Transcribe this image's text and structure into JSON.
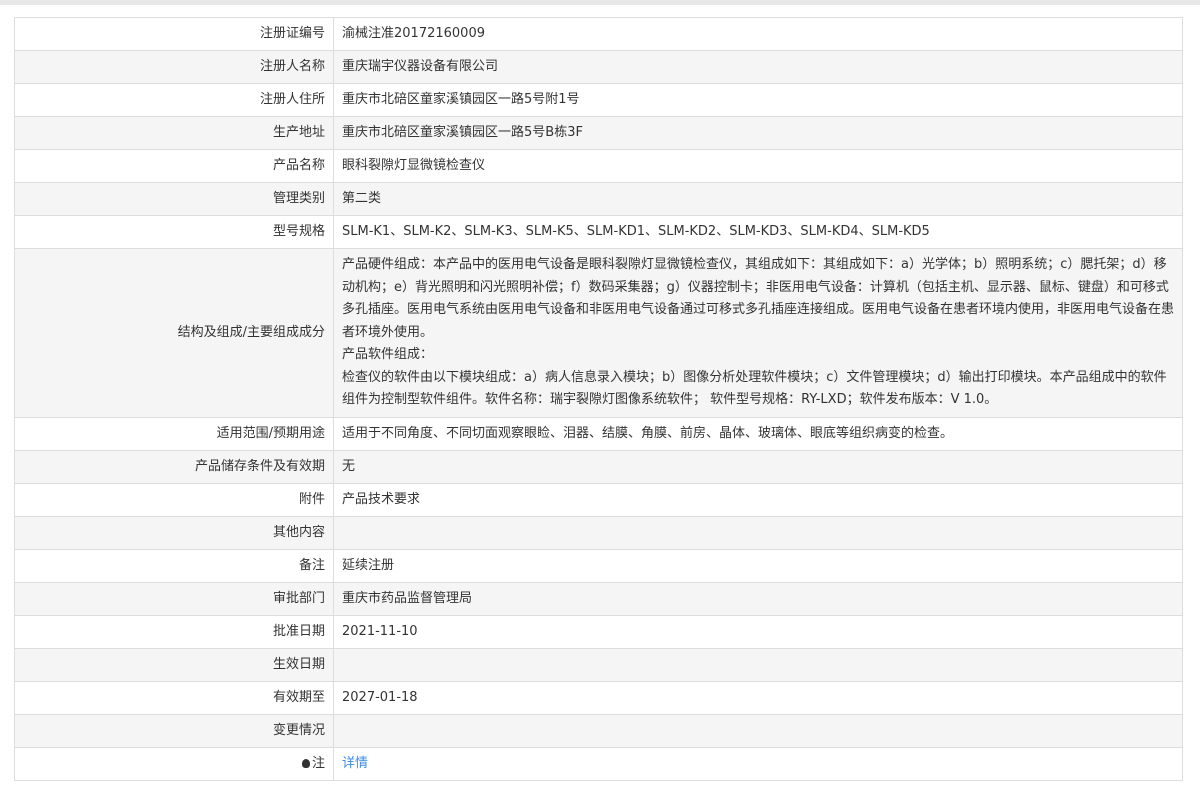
{
  "rows": [
    {
      "label": "注册证编号",
      "value": "渝械注准20172160009"
    },
    {
      "label": "注册人名称",
      "value": "重庆瑞宇仪器设备有限公司"
    },
    {
      "label": "注册人住所",
      "value": "重庆市北碚区童家溪镇园区一路5号附1号"
    },
    {
      "label": "生产地址",
      "value": "重庆市北碚区童家溪镇园区一路5号B栋3F"
    },
    {
      "label": "产品名称",
      "value": "眼科裂隙灯显微镜检查仪"
    },
    {
      "label": "管理类别",
      "value": "第二类"
    },
    {
      "label": "型号规格",
      "value": "SLM-K1、SLM-K2、SLM-K3、SLM-K5、SLM-KD1、SLM-KD2、SLM-KD3、SLM-KD4、SLM-KD5"
    },
    {
      "label": "结构及组成/主要组成成分",
      "lines": [
        "产品硬件组成：本产品中的医用电气设备是眼科裂隙灯显微镜检查仪，其组成如下：其组成如下：a）光学体；b）照明系统；c）腮托架；d）移动机构；e）背光照明和闪光照明补偿；f）数码采集器；g）仪器控制卡；非医用电气设备：计算机（包括主机、显示器、鼠标、键盘）和可移式多孔插座。医用电气系统由医用电气设备和非医用电气设备通过可移式多孔插座连接组成。医用电气设备在患者环境内使用，非医用电气设备在患者环境外使用。",
        "产品软件组成：",
        "检查仪的软件由以下模块组成：a）病人信息录入模块；b）图像分析处理软件模块；c）文件管理模块；d）输出打印模块。本产品组成中的软件组件为控制型软件组件。软件名称：瑞宇裂隙灯图像系统软件； 软件型号规格：RY-LXD；软件发布版本：V 1.0。"
      ]
    },
    {
      "label": "适用范围/预期用途",
      "value": "适用于不同角度、不同切面观察眼睑、泪器、结膜、角膜、前房、晶体、玻璃体、眼底等组织病变的检查。"
    },
    {
      "label": "产品储存条件及有效期",
      "value": "无"
    },
    {
      "label": "附件",
      "value": "产品技术要求"
    },
    {
      "label": "其他内容",
      "value": ""
    },
    {
      "label": "备注",
      "value": "延续注册"
    },
    {
      "label": "审批部门",
      "value": "重庆市药品监督管理局"
    },
    {
      "label": "批准日期",
      "value": "2021-11-10"
    },
    {
      "label": "生效日期",
      "value": ""
    },
    {
      "label": "有效期至",
      "value": "2027-01-18"
    },
    {
      "label": "变更情况",
      "value": ""
    },
    {
      "label": "注",
      "value": "详情",
      "icon": "lightbulb-icon"
    }
  ]
}
